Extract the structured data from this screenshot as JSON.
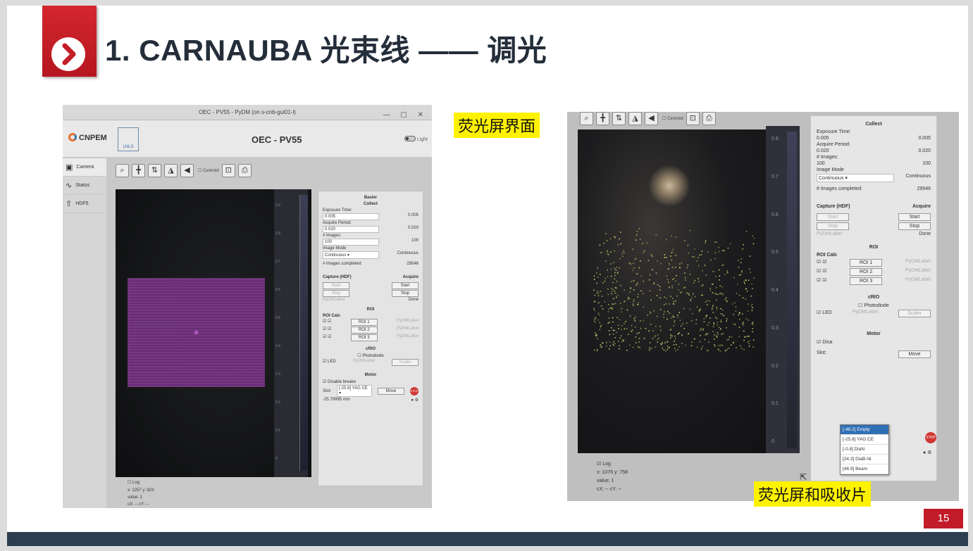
{
  "slide": {
    "title": "1. CARNAUBA 光束线 —— 调光",
    "page_number": "15",
    "label_screen": "荧光屏界面",
    "label_absorber": "荧光屏和吸收片"
  },
  "left_screen": {
    "window_title": "OEC - PV55 - PyDM (on s-cnb-gui01-l)",
    "brand": "CNPEM",
    "lnls": "LNLS",
    "app_title": "OEC - PV55",
    "theme_toggle": "Light",
    "sidebar": [
      {
        "icon": "camera-icon",
        "glyph": "▣",
        "label": "Camera"
      },
      {
        "icon": "status-icon",
        "glyph": "∿",
        "label": "Status"
      },
      {
        "icon": "upload-icon",
        "glyph": "⇧",
        "label": "HDF5"
      }
    ],
    "toolbar_centroid": "Centroid",
    "ticks": [
      "0.9",
      "0.8",
      "0.7",
      "0.6",
      "0.5",
      "0.4",
      "0.3",
      "0.2",
      "0.1",
      "0"
    ],
    "panel": {
      "device": "Basler",
      "collect": "Collect",
      "exposure_label": "Exposure Time:",
      "exposure_set": "0.005",
      "exposure_rbv": "0.005",
      "acquire_label": "Acquire Period:",
      "acquire_set": "0.020",
      "acquire_rbv": "0.020",
      "images_label": "# Images:",
      "images_set": "100",
      "images_rbv": "100",
      "mode_label": "Image Mode",
      "mode_value": "Continuous",
      "mode_rbv": "Continuous",
      "completed_label": "# Images completed:",
      "completed_value": "29546",
      "capture_hdr": "Capture (HDF)",
      "acquire_hdr": "Acquire",
      "start": "Start",
      "stop": "Stop",
      "pydm_label": "PyDMLabel",
      "done": "Done",
      "roi_hdr": "ROI",
      "roi_calc": "ROI Calc",
      "rois": [
        "ROI 1",
        "ROI 2",
        "ROI 3"
      ],
      "crio_hdr": "cRIO",
      "photodiode": "Photodiode",
      "led": "LED",
      "scaler": "Scaler",
      "motor_hdr": "Motor",
      "disable_brake": "Disable breake",
      "slot_label": "Slot:",
      "slot_value": "[-25.8] YAG CE",
      "move": "Move",
      "stop_icon": "STOP",
      "position": "-25.79995 mm"
    },
    "status": {
      "log": "Log",
      "xy": "x: 1257   y: 823",
      "value": "value: 1",
      "cxcy": "cX: --     cY: --"
    }
  },
  "right_screen": {
    "toolbar_centroid": "Centroid",
    "ticks": [
      "0.8",
      "0.7",
      "0.6",
      "0.5",
      "0.4",
      "0.3",
      "0.2",
      "0.1",
      "0"
    ],
    "panel": {
      "collect": "Collect",
      "exposure_label": "Exposure Time:",
      "exposure_set": "0.005",
      "exposure_rbv": "0.005",
      "acquire_label": "Acquire Period:",
      "acquire_set": "0.020",
      "acquire_rbv": "0.020",
      "images_label": "# Images:",
      "images_set": "100",
      "images_rbv": "100",
      "mode_label": "Image Mode",
      "mode_value": "Continuous",
      "mode_rbv": "Continuous",
      "completed_label": "# Images completed:",
      "completed_value": "29546",
      "capture_hdr": "Capture (HDF)",
      "acquire_hdr": "Acquire",
      "start": "Start",
      "stop": "Stop",
      "pydm_label": "PyDMLabel",
      "done": "Done",
      "roi_hdr": "ROI",
      "roi_calc": "ROI Calc",
      "rois": [
        "ROI 1",
        "ROI 2",
        "ROI 3"
      ],
      "crio_hdr": "cRIO",
      "photodiode": "Photodiode",
      "led": "LED",
      "scaler": "Scaler",
      "motor_hdr": "Motor",
      "disable": "Disa",
      "slot_label": "Slot:",
      "move": "Move",
      "stop_icon": "STOP"
    },
    "dropdown": [
      "[-48.2] Empty",
      "[-25.8] YAG:CE",
      "[-0.8] DiaN",
      "[24.3] DiaB-Ni",
      "[48.9] Beam"
    ],
    "status": {
      "log": "Log",
      "xy": "x: 1076   y: 758",
      "value": "value: 1",
      "cxcy": "cX: --     cY: --"
    }
  }
}
